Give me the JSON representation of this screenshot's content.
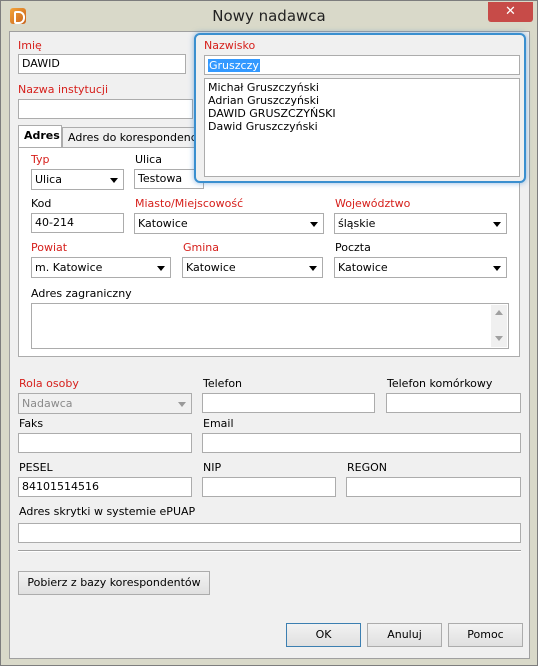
{
  "window": {
    "title": "Nowy nadawca",
    "close_glyph": "✕"
  },
  "labels": {
    "imie": "Imię",
    "nazwisko": "Nazwisko",
    "nazwa_instytucji": "Nazwa instytucji",
    "typ": "Typ",
    "ulica": "Ulica",
    "kod": "Kod",
    "miasto": "Miasto/Miejscowość",
    "wojewodztwo": "Województwo",
    "powiat": "Powiat",
    "gmina": "Gmina",
    "poczta": "Poczta",
    "adres_zagraniczny": "Adres zagraniczny",
    "rola_osoby": "Rola osoby",
    "telefon": "Telefon",
    "telefon_komorkowy": "Telefon komórkowy",
    "faks": "Faks",
    "email": "Email",
    "pesel": "PESEL",
    "nip": "NIP",
    "regon": "REGON",
    "adres_skrytki": "Adres skrytki w systemie ePUAP"
  },
  "values": {
    "imie": "DAWID",
    "nazwisko": "Gruszczy",
    "nazwa_instytucji": "",
    "typ": "Ulica",
    "ulica": "Testowa",
    "kod": "40-214",
    "miasto": "Katowice",
    "wojewodztwo": "śląskie",
    "powiat": "m. Katowice",
    "gmina": "Katowice",
    "poczta": "Katowice",
    "adres_zagraniczny": "",
    "rola_osoby": "Nadawca",
    "telefon": "",
    "telefon_komorkowy": "",
    "faks": "",
    "email": "",
    "pesel": "84101514516",
    "nip": "",
    "regon": "",
    "adres_skrytki": ""
  },
  "tabs": [
    {
      "label": "Adres",
      "active": true
    },
    {
      "label": "Adres do korespondencji",
      "active": false
    }
  ],
  "suggestions": [
    "Michał Gruszczyński",
    "Adrian Gruszczyński",
    "DAWID GRUSZCZYŃSKI",
    "Dawid Gruszczyński"
  ],
  "buttons": {
    "pobierz": "Pobierz z bazy korespondentów",
    "ok": "OK",
    "anuluj": "Anuluj",
    "pomoc": "Pomoc"
  },
  "colors": {
    "required_label": "#d6201c",
    "popup_border": "#3a8fcf",
    "selection": "#3399ff"
  }
}
